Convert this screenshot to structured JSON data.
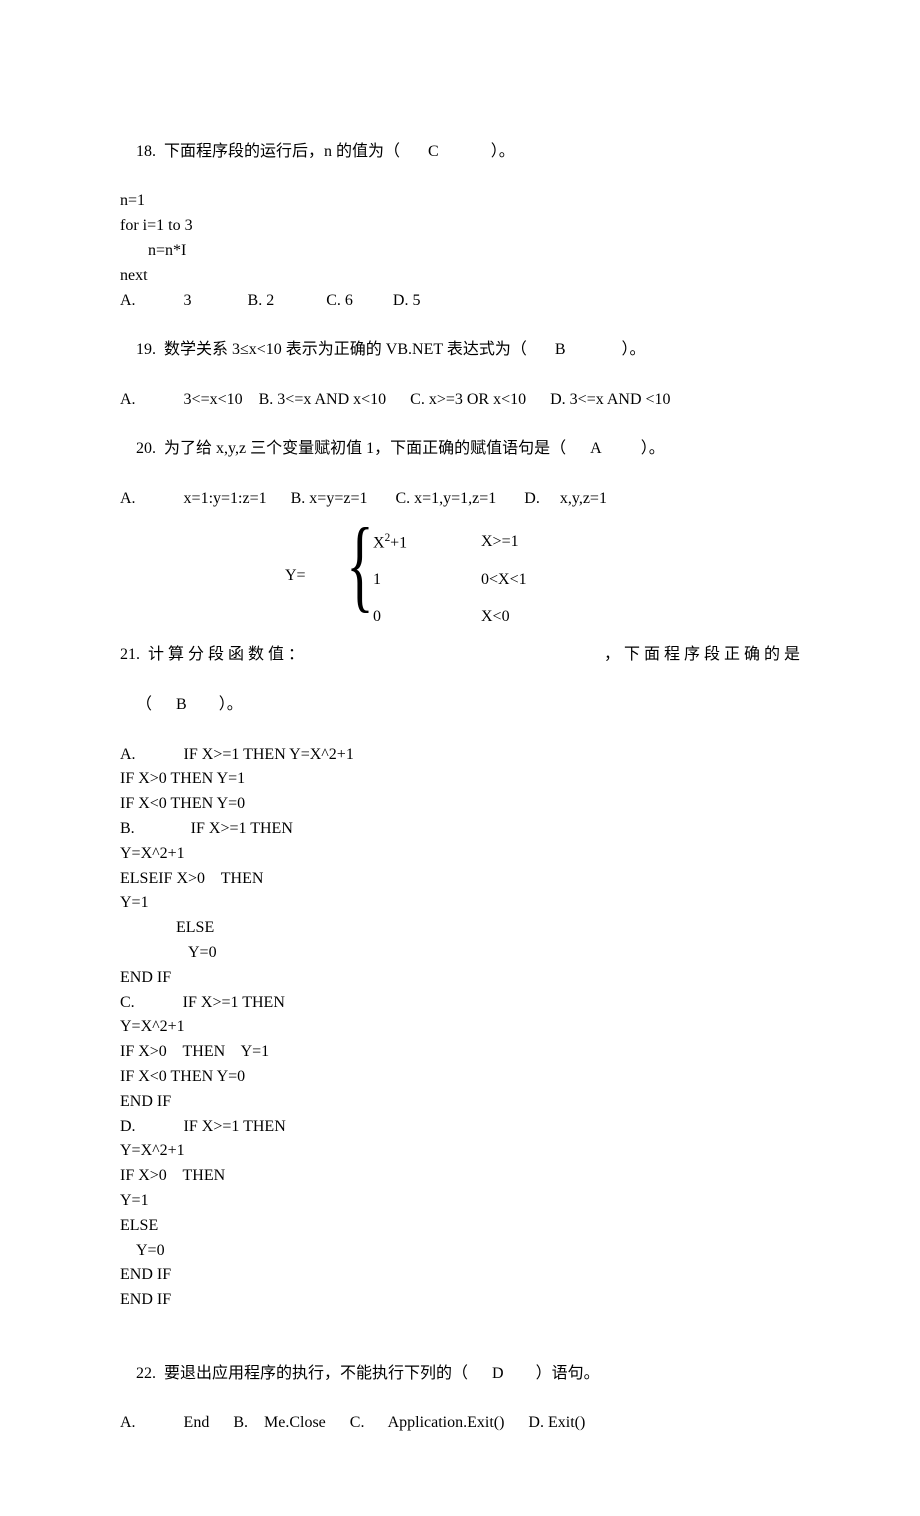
{
  "q18": {
    "stem_a": "18.  下面程序段的运行后，n 的值为（",
    "ans": "C",
    "stem_b": "）。",
    "code1": "n=1",
    "code2": "for i=1 to 3",
    "code3": "n=n*I",
    "code4": "next",
    "opts": "A.            3              B. 2             C. 6          D. 5"
  },
  "q19": {
    "stem_a": "19.  数学关系 3≤x<10 表示为正确的 VB.NET 表达式为（",
    "ans": "B",
    "stem_b": "）。",
    "opts": "A.            3<=x<10    B. 3<=x AND x<10      C. x>=3 OR x<10      D. 3<=x AND <10"
  },
  "q20": {
    "stem_a": "20.  为了给 x,y,z 三个变量赋初值 1，下面正确的赋值语句是（",
    "ans": "A",
    "stem_b": "）。",
    "opts": "A.            x=1:y=1:z=1      B. x=y=z=1       C. x=1,y=1,z=1       D.     x,y,z=1"
  },
  "q21": {
    "pw": {
      "y": "Y=",
      "r1a": "X",
      "r1a2": "+1",
      "r1b": "X>=1",
      "r2a": "1",
      "r2b": "0<X<1",
      "r3a": "0",
      "r3b": "X<0"
    },
    "stem_left": "21.  计 算 分 段 函 数 值 ：",
    "stem_right": "， 下 面 程 序 段 正 确 的 是",
    "stem2_a": "（",
    "ans": "B",
    "stem2_b": "）。",
    "a0": "A.            IF X>=1 THEN Y=X^2+1",
    "a1": "IF X>0 THEN Y=1",
    "a2": "IF X<0 THEN Y=0",
    "b0": "B.              IF X>=1 THEN",
    "b1": "Y=X^2+1",
    "b2": "ELSEIF X>0    THEN",
    "b3": "Y=1",
    "b4": "              ELSE",
    "b5": "                 Y=0",
    "b6": "END IF",
    "c0": "C.            IF X>=1 THEN",
    "c1": "Y=X^2+1",
    "c2": "IF X>0    THEN    Y=1",
    "c3": "IF X<0 THEN Y=0",
    "c4": "END IF",
    "d0": "D.            IF X>=1 THEN",
    "d1": "Y=X^2+1",
    "d2": "IF X>0    THEN",
    "d3": "Y=1",
    "d4": "ELSE",
    "d5": "    Y=0",
    "d6": "END IF",
    "d7": "END IF"
  },
  "q22": {
    "stem_a": "22.  要退出应用程序的执行，不能执行下列的（",
    "ans": "D",
    "stem_b": "）语句。",
    "opts": "A.            End      B.    Me.Close      C.      Application.Exit()      D. Exit()"
  }
}
